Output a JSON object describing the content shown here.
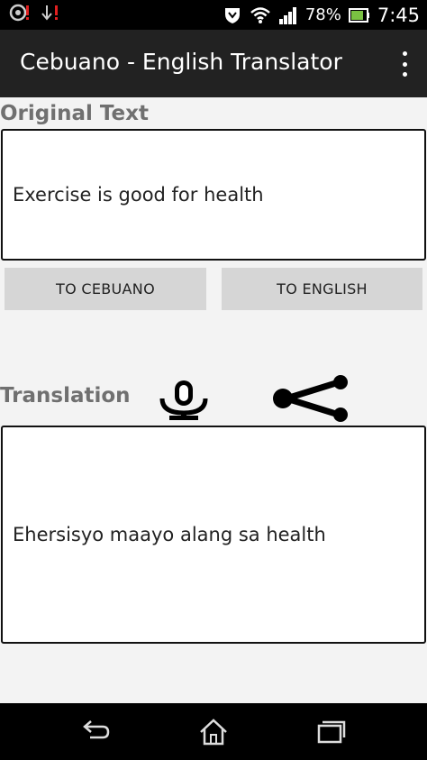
{
  "status_bar": {
    "battery": "78%",
    "time": "7:45",
    "icons": [
      "messenger-icon",
      "download-icon",
      "shield-icon",
      "wifi-icon",
      "signal-icon",
      "battery-icon"
    ]
  },
  "action_bar": {
    "title": "Cebuano - English Translator"
  },
  "original": {
    "label": "Original Text",
    "text": "Exercise is good for health"
  },
  "buttons": {
    "to_cebuano": "TO CEBUANO",
    "to_english": "TO ENGLISH"
  },
  "translation": {
    "label": "Translation",
    "text": "Ehersisyo maayo alang sa health"
  },
  "nav": {
    "icons": [
      "back-icon",
      "home-icon",
      "recents-icon"
    ]
  },
  "colors": {
    "action_bar": "#222222",
    "background": "#f3f3f3",
    "button": "#d6d6d6",
    "label": "#707070"
  }
}
